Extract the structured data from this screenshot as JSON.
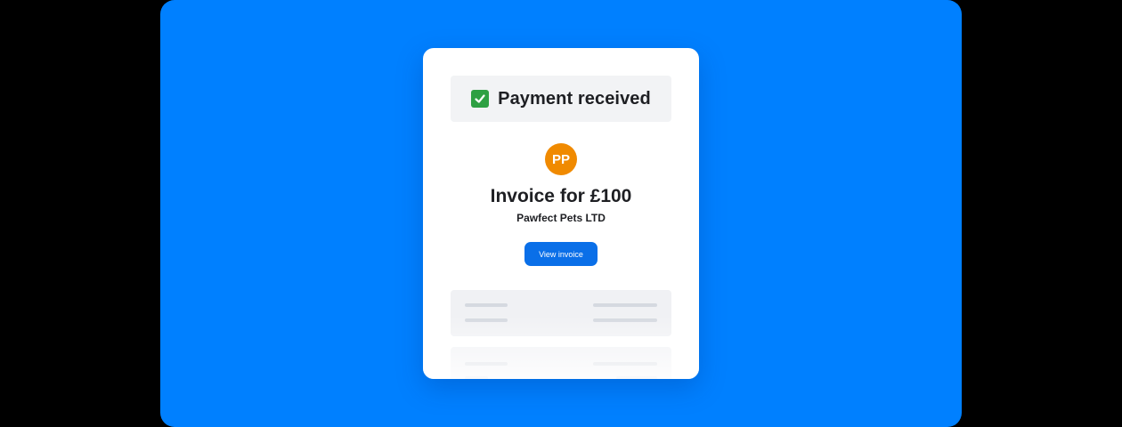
{
  "colors": {
    "background": "#0080FF",
    "check": "#2EA043",
    "avatar": "#F08A00",
    "button": "#0A6FE8"
  },
  "banner": {
    "icon": "check-mark-icon",
    "title": "Payment received"
  },
  "avatar": {
    "initials": "PP"
  },
  "invoice": {
    "title": "Invoice for £100",
    "company": "Pawfect Pets LTD",
    "button_label": "View invoice"
  },
  "placeholder_rows": 2
}
